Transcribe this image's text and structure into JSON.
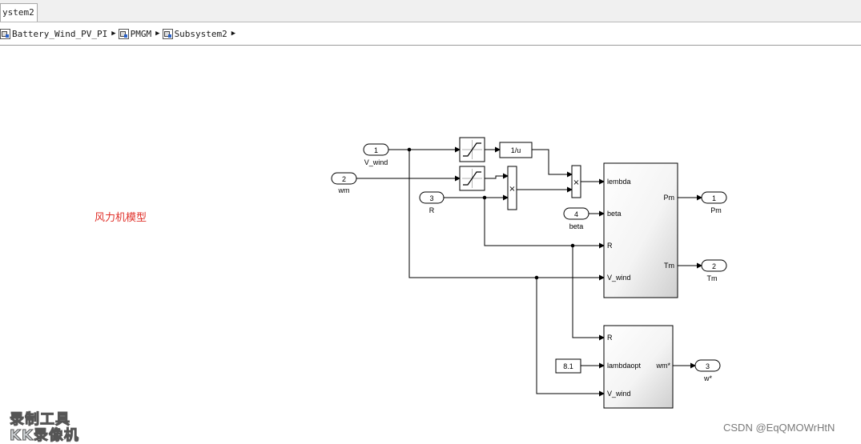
{
  "tab": {
    "label": "ystem2"
  },
  "breadcrumb": [
    {
      "label": "Battery_Wind_PV_PI"
    },
    {
      "label": "PMGM"
    },
    {
      "label": "Subsystem2"
    }
  ],
  "annotation": {
    "text": "风力机模型",
    "color": "#e0312a"
  },
  "inports": [
    {
      "num": "1",
      "label": "V_wind"
    },
    {
      "num": "2",
      "label": "wm"
    },
    {
      "num": "3",
      "label": "R"
    },
    {
      "num": "4",
      "label": "beta"
    }
  ],
  "outports": [
    {
      "num": "1",
      "label": "Pm"
    },
    {
      "num": "2",
      "label": "Tm"
    },
    {
      "num": "3",
      "label": "w*"
    }
  ],
  "blocks": {
    "reciprocal": "1/u",
    "product_symbol": "×",
    "constant": "8.1",
    "turbine": {
      "inputs": [
        "lembda",
        "beta",
        "R",
        "V_wind"
      ],
      "outputs": [
        "Pm",
        "Tm"
      ]
    },
    "speed_ref": {
      "inputs": [
        "R",
        "lambdaopt",
        "V_wind"
      ],
      "outputs": [
        "wm*"
      ]
    }
  },
  "watermark": {
    "line1": "录制工具",
    "line2": "KK录像机"
  },
  "footer": {
    "text": "CSDN @EqQMOWrHtN"
  }
}
